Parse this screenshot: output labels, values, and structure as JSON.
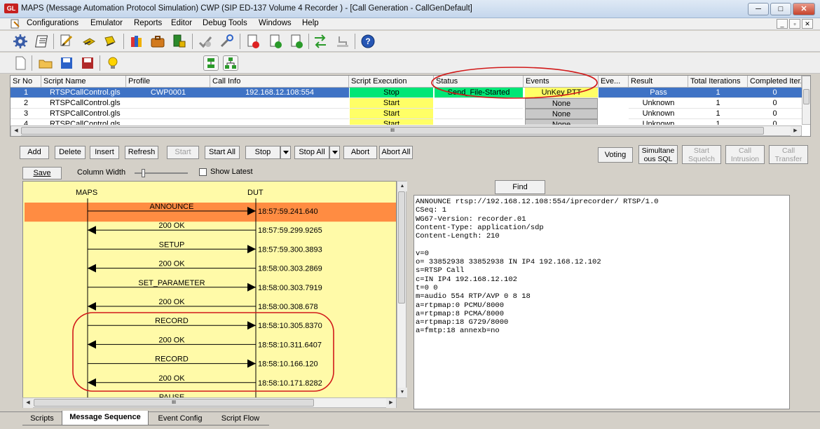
{
  "window": {
    "title": "MAPS (Message Automation Protocol Simulation) CWP (SIP ED-137 Volume 4 Recorder ) - [Call Generation  - CallGenDefault]",
    "logo": "GL",
    "controls": [
      "minimize-icon",
      "maximize-icon",
      "close-icon"
    ]
  },
  "menu": {
    "items": [
      "Configurations",
      "Emulator",
      "Reports",
      "Editor",
      "Debug Tools",
      "Windows",
      "Help"
    ],
    "mdi_controls": [
      "_",
      "▫",
      "✕"
    ]
  },
  "grid": {
    "columns": [
      "Sr No",
      "Script Name",
      "Profile",
      "Call Info",
      "Script Execution",
      "Status",
      "Events",
      "Eve...",
      "Result",
      "Total Iterations",
      "Completed Iter..."
    ],
    "rows": [
      {
        "sr": "1",
        "script": "RTSPCallControl.gls",
        "profile": "CWP0001",
        "callinfo": "192.168.12.108:554",
        "exec": "Stop",
        "status": "Send_File-Started",
        "events": "UnKey PTT",
        "eve": "",
        "result": "Pass",
        "total": "1",
        "completed": "0"
      },
      {
        "sr": "2",
        "script": "RTSPCallControl.gls",
        "profile": "",
        "callinfo": "",
        "exec": "Start",
        "status": "",
        "events": "None",
        "eve": "",
        "result": "Unknown",
        "total": "1",
        "completed": "0"
      },
      {
        "sr": "3",
        "script": "RTSPCallControl.gls",
        "profile": "",
        "callinfo": "",
        "exec": "Start",
        "status": "",
        "events": "None",
        "eve": "",
        "result": "Unknown",
        "total": "1",
        "completed": "0"
      },
      {
        "sr": "4",
        "script": "RTSPCallControl.gls",
        "profile": "",
        "callinfo": "",
        "exec": "Start",
        "status": "",
        "events": "None",
        "eve": "",
        "result": "Unknown",
        "total": "1",
        "completed": "0"
      }
    ],
    "hscroll_thumb": "III"
  },
  "actions": {
    "add": "Add",
    "delete": "Delete",
    "insert": "Insert",
    "refresh": "Refresh",
    "start": "Start",
    "start_all": "Start All",
    "stop": "Stop",
    "stop_all": "Stop All",
    "abort": "Abort",
    "abort_all": "Abort All",
    "voting": "Voting",
    "simultaneous_sql": "Simultane\nous SQL",
    "start_squelch": "Start\nSquelch",
    "call_intrusion": "Call\nIntrusion",
    "call_transfer": "Call\nTransfer"
  },
  "seq_controls": {
    "save": "Save",
    "column_width": "Column Width",
    "show_latest": "Show Latest",
    "show_latest_checked": false
  },
  "sequence": {
    "left_header": "MAPS",
    "right_header": "DUT",
    "messages": [
      {
        "label": "ANNOUNCE",
        "dir": "right",
        "time": "18:57:59.241.640",
        "highlight": true
      },
      {
        "label": "200  OK",
        "dir": "left",
        "time": "18:57:59.299.9265",
        "highlight": false
      },
      {
        "label": "SETUP",
        "dir": "right",
        "time": "18:57:59.300.3893",
        "highlight": false
      },
      {
        "label": "200  OK",
        "dir": "left",
        "time": "18:58:00.303.2869",
        "highlight": false
      },
      {
        "label": "SET_PARAMETER",
        "dir": "right",
        "time": "18:58:00.303.7919",
        "highlight": false
      },
      {
        "label": "200  OK",
        "dir": "left",
        "time": "18:58:00.308.678",
        "highlight": false
      },
      {
        "label": "RECORD",
        "dir": "right",
        "time": "18:58:10.305.8370",
        "highlight": false
      },
      {
        "label": "200  OK",
        "dir": "left",
        "time": "18:58:10.311.6407",
        "highlight": false
      },
      {
        "label": "RECORD",
        "dir": "right",
        "time": "18:58:10.166.120",
        "highlight": false
      },
      {
        "label": "200  OK",
        "dir": "left",
        "time": "18:58:10.171.8282",
        "highlight": false
      },
      {
        "label": "PAUSE",
        "dir": "right",
        "time": "",
        "highlight": false
      }
    ],
    "hscroll_thumb": "III"
  },
  "detail": {
    "find": "Find",
    "lines": [
      "ANNOUNCE rtsp://192.168.12.108:554/iprecorder/ RTSP/1.0",
      "CSeq: 1",
      "WG67-Version: recorder.01",
      "Content-Type: application/sdp",
      "Content-Length: 210",
      "",
      "v=0",
      "o= 33852938 33852938 IN IP4 192.168.12.102",
      "s=RTSP Call",
      "c=IN IP4 192.168.12.102",
      "t=0 0",
      "m=audio 554 RTP/AVP 0 8 18",
      "a=rtpmap:0 PCMU/8000",
      "a=rtpmap:8 PCMA/8000",
      "a=rtpmap:18 G729/8000",
      "a=fmtp:18 annexb=no"
    ]
  },
  "tabs": [
    "Scripts",
    "Message Sequence",
    "Event Config",
    "Script Flow"
  ],
  "active_tab": "Message Sequence",
  "colors": {
    "selected_row": "#3f73c5",
    "stop_green": "#00e676",
    "start_yellow": "#ffff66",
    "sequence_bg": "#fffaa8",
    "highlight_orange": "#ff8c42",
    "annotation_red": "#d11a1a"
  }
}
